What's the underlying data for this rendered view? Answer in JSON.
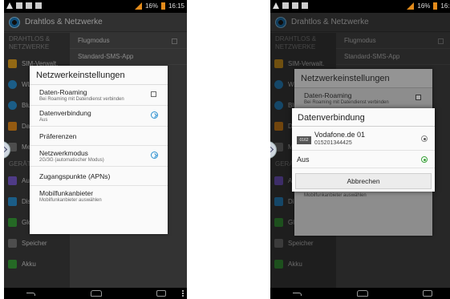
{
  "status": {
    "battery": "16%",
    "time_left": "16:15",
    "time_right": "16:1"
  },
  "app": {
    "title": "Drahtlos & Netzwerke"
  },
  "left_pane": {
    "section1": "DRAHTLOS & NETZWERKE",
    "items": [
      {
        "label": "SIM-Verwalt.",
        "color": "#e0a020"
      },
      {
        "label": "WLAN",
        "color": "#2a8fd0"
      },
      {
        "label": "Bluetooth",
        "color": "#2a8fd0"
      },
      {
        "label": "Datennutz.",
        "color": "#e38b1b"
      },
      {
        "label": "Mehr",
        "color": "#777777"
      }
    ],
    "section2": "GERÄT",
    "items2": [
      {
        "label": "Audioprofile",
        "color": "#7a5bd0"
      },
      {
        "label": "Display",
        "color": "#2a8fd0"
      },
      {
        "label": "GloveMode",
        "color": "#3aa13a"
      },
      {
        "label": "Speicher",
        "color": "#777777"
      },
      {
        "label": "Akku",
        "color": "#3aa13a"
      }
    ]
  },
  "right_pane": {
    "rows": [
      {
        "label": "Flugmodus"
      },
      {
        "label": "Standard-SMS-App"
      }
    ]
  },
  "dialog": {
    "title": "Netzwerkeinstellungen",
    "items": [
      {
        "title": "Daten-Roaming",
        "sub": "Bei Roaming mit Datendienst verbinden"
      },
      {
        "title": "Datenverbindung",
        "sub": "Aus"
      },
      {
        "title": "Präferenzen",
        "sub": ""
      },
      {
        "title": "Netzwerkmodus",
        "sub": "2G/3G (automatischer Modus)"
      },
      {
        "title": "Zugangspunkte (APNs)",
        "sub": ""
      },
      {
        "title": "Mobilfunkanbieter",
        "sub": "Mobilfunkanbieter auswählen"
      }
    ]
  },
  "front_dialog": {
    "title": "Datenverbindung",
    "sim_badge": "0162",
    "carrier": "Vodafone.de 01",
    "carrier_number": "015201344425",
    "off_label": "Aus",
    "cancel": "Abbrechen"
  }
}
